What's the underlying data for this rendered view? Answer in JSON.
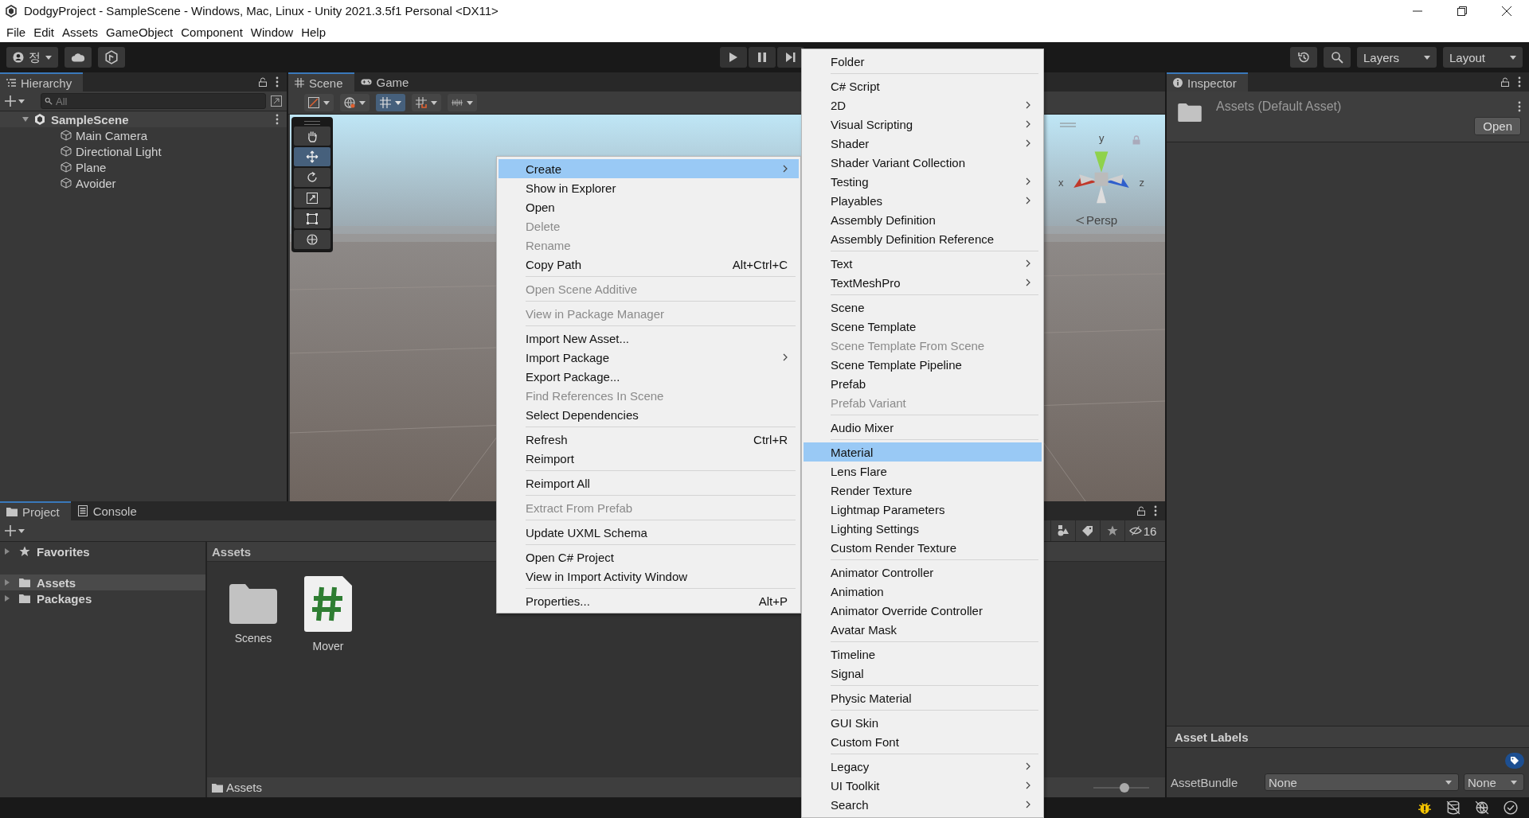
{
  "window": {
    "title": "DodgyProject - SampleScene - Windows, Mac, Linux - Unity 2021.3.5f1 Personal <DX11>"
  },
  "menubar": [
    "File",
    "Edit",
    "Assets",
    "GameObject",
    "Component",
    "Window",
    "Help"
  ],
  "toolbar": {
    "account": "정",
    "layers": "Layers",
    "layout": "Layout"
  },
  "hierarchy": {
    "title": "Hierarchy",
    "search_placeholder": "All",
    "scene": "SampleScene",
    "items": [
      "Main Camera",
      "Directional Light",
      "Plane",
      "Avoider"
    ]
  },
  "scene_view": {
    "tabs": [
      {
        "label": "Scene",
        "selected": true
      },
      {
        "label": "Game",
        "selected": false
      }
    ],
    "tools": [
      {
        "kind": "hand",
        "selected": false
      },
      {
        "kind": "move",
        "selected": true
      },
      {
        "kind": "rotate",
        "selected": false
      },
      {
        "kind": "scale",
        "selected": false
      },
      {
        "kind": "rect",
        "selected": false
      },
      {
        "kind": "transform",
        "selected": false
      }
    ],
    "axes": [
      "y",
      "x",
      "z"
    ],
    "projection": "Persp"
  },
  "inspector": {
    "title": "Inspector",
    "asset": "Assets (Default Asset)",
    "open_button": "Open",
    "labels_header": "Asset Labels",
    "assetbundle_label": "AssetBundle",
    "assetbundle": "None",
    "variant": "None"
  },
  "project": {
    "tabs": [
      {
        "label": "Project",
        "selected": true
      },
      {
        "label": "Console",
        "selected": false
      }
    ],
    "tree": [
      {
        "label": "Favorites",
        "kind": "favorites",
        "selected": false
      },
      {
        "label": "Assets",
        "kind": "folder",
        "selected": true
      },
      {
        "label": "Packages",
        "kind": "folder",
        "selected": false
      }
    ],
    "breadcrumb": "Assets",
    "hidden_count": "16",
    "items": [
      {
        "name": "Scenes",
        "kind": "folder"
      },
      {
        "name": "Mover",
        "kind": "script"
      }
    ],
    "footer_path": "Assets",
    "zoom": {
      "level": 0.55
    }
  },
  "context_menu": [
    [
      {
        "label": "Create",
        "submenu": true,
        "selected": true,
        "disabled": false
      },
      {
        "label": "Show in Explorer",
        "submenu": false,
        "selected": false,
        "disabled": false
      },
      {
        "label": "Open",
        "submenu": false,
        "selected": false,
        "disabled": false
      },
      {
        "label": "Delete",
        "submenu": false,
        "selected": false,
        "disabled": true
      },
      {
        "label": "Rename",
        "submenu": false,
        "selected": false,
        "disabled": true
      },
      {
        "label": "Copy Path",
        "shortcut": "Alt+Ctrl+C",
        "submenu": false,
        "selected": false,
        "disabled": false
      }
    ],
    [
      {
        "label": "Open Scene Additive",
        "submenu": false,
        "selected": false,
        "disabled": true
      }
    ],
    [
      {
        "label": "View in Package Manager",
        "submenu": false,
        "selected": false,
        "disabled": true
      }
    ],
    [
      {
        "label": "Import New Asset...",
        "submenu": false,
        "selected": false,
        "disabled": false
      },
      {
        "label": "Import Package",
        "submenu": true,
        "selected": false,
        "disabled": false
      },
      {
        "label": "Export Package...",
        "submenu": false,
        "selected": false,
        "disabled": false
      },
      {
        "label": "Find References In Scene",
        "submenu": false,
        "selected": false,
        "disabled": true
      },
      {
        "label": "Select Dependencies",
        "submenu": false,
        "selected": false,
        "disabled": false
      }
    ],
    [
      {
        "label": "Refresh",
        "shortcut": "Ctrl+R",
        "submenu": false,
        "selected": false,
        "disabled": false
      },
      {
        "label": "Reimport",
        "submenu": false,
        "selected": false,
        "disabled": false
      }
    ],
    [
      {
        "label": "Reimport All",
        "submenu": false,
        "selected": false,
        "disabled": false
      }
    ],
    [
      {
        "label": "Extract From Prefab",
        "submenu": false,
        "selected": false,
        "disabled": true
      }
    ],
    [
      {
        "label": "Update UXML Schema",
        "submenu": false,
        "selected": false,
        "disabled": false
      }
    ],
    [
      {
        "label": "Open C# Project",
        "submenu": false,
        "selected": false,
        "disabled": false
      },
      {
        "label": "View in Import Activity Window",
        "submenu": false,
        "selected": false,
        "disabled": false
      }
    ],
    [
      {
        "label": "Properties...",
        "shortcut": "Alt+P",
        "submenu": false,
        "selected": false,
        "disabled": false
      }
    ]
  ],
  "create_submenu": [
    [
      {
        "label": "Folder",
        "submenu": false,
        "selected": false,
        "disabled": false
      }
    ],
    [
      {
        "label": "C# Script",
        "submenu": false,
        "selected": false,
        "disabled": false
      },
      {
        "label": "2D",
        "submenu": true,
        "selected": false,
        "disabled": false
      },
      {
        "label": "Visual Scripting",
        "submenu": true,
        "selected": false,
        "disabled": false
      },
      {
        "label": "Shader",
        "submenu": true,
        "selected": false,
        "disabled": false
      },
      {
        "label": "Shader Variant Collection",
        "submenu": false,
        "selected": false,
        "disabled": false
      },
      {
        "label": "Testing",
        "submenu": true,
        "selected": false,
        "disabled": false
      },
      {
        "label": "Playables",
        "submenu": true,
        "selected": false,
        "disabled": false
      },
      {
        "label": "Assembly Definition",
        "submenu": false,
        "selected": false,
        "disabled": false
      },
      {
        "label": "Assembly Definition Reference",
        "submenu": false,
        "selected": false,
        "disabled": false
      }
    ],
    [
      {
        "label": "Text",
        "submenu": true,
        "selected": false,
        "disabled": false
      },
      {
        "label": "TextMeshPro",
        "submenu": true,
        "selected": false,
        "disabled": false
      }
    ],
    [
      {
        "label": "Scene",
        "submenu": false,
        "selected": false,
        "disabled": false
      },
      {
        "label": "Scene Template",
        "submenu": false,
        "selected": false,
        "disabled": false
      },
      {
        "label": "Scene Template From Scene",
        "submenu": false,
        "selected": false,
        "disabled": true
      },
      {
        "label": "Scene Template Pipeline",
        "submenu": false,
        "selected": false,
        "disabled": false
      },
      {
        "label": "Prefab",
        "submenu": false,
        "selected": false,
        "disabled": false
      },
      {
        "label": "Prefab Variant",
        "submenu": false,
        "selected": false,
        "disabled": true
      }
    ],
    [
      {
        "label": "Audio Mixer",
        "submenu": false,
        "selected": false,
        "disabled": false
      }
    ],
    [
      {
        "label": "Material",
        "submenu": false,
        "selected": true,
        "disabled": false
      },
      {
        "label": "Lens Flare",
        "submenu": false,
        "selected": false,
        "disabled": false
      },
      {
        "label": "Render Texture",
        "submenu": false,
        "selected": false,
        "disabled": false
      },
      {
        "label": "Lightmap Parameters",
        "submenu": false,
        "selected": false,
        "disabled": false
      },
      {
        "label": "Lighting Settings",
        "submenu": false,
        "selected": false,
        "disabled": false
      },
      {
        "label": "Custom Render Texture",
        "submenu": false,
        "selected": false,
        "disabled": false
      }
    ],
    [
      {
        "label": "Animator Controller",
        "submenu": false,
        "selected": false,
        "disabled": false
      },
      {
        "label": "Animation",
        "submenu": false,
        "selected": false,
        "disabled": false
      },
      {
        "label": "Animator Override Controller",
        "submenu": false,
        "selected": false,
        "disabled": false
      },
      {
        "label": "Avatar Mask",
        "submenu": false,
        "selected": false,
        "disabled": false
      }
    ],
    [
      {
        "label": "Timeline",
        "submenu": false,
        "selected": false,
        "disabled": false
      },
      {
        "label": "Signal",
        "submenu": false,
        "selected": false,
        "disabled": false
      }
    ],
    [
      {
        "label": "Physic Material",
        "submenu": false,
        "selected": false,
        "disabled": false
      }
    ],
    [
      {
        "label": "GUI Skin",
        "submenu": false,
        "selected": false,
        "disabled": false
      },
      {
        "label": "Custom Font",
        "submenu": false,
        "selected": false,
        "disabled": false
      }
    ],
    [
      {
        "label": "Legacy",
        "submenu": true,
        "selected": false,
        "disabled": false
      },
      {
        "label": "UI Toolkit",
        "submenu": true,
        "selected": false,
        "disabled": false
      },
      {
        "label": "Search",
        "submenu": true,
        "selected": false,
        "disabled": false
      }
    ]
  ]
}
